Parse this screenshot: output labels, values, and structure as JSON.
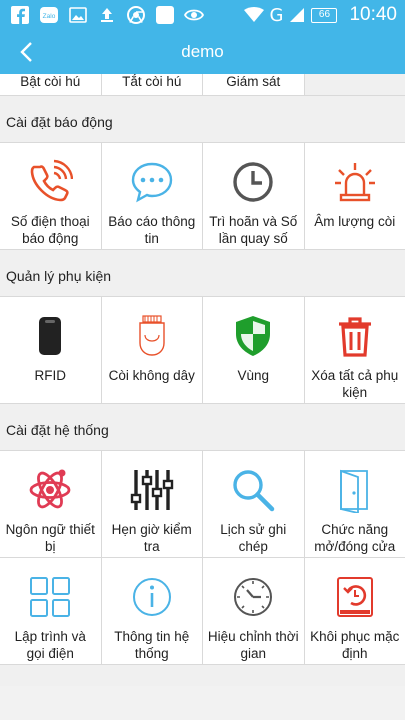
{
  "status_bar": {
    "time": "10:40",
    "battery": "66",
    "network": "G",
    "notification_icons": [
      "facebook-icon",
      "zalo-icon",
      "image-icon",
      "upload-icon",
      "chrome-icon",
      "app-icon",
      "eye-icon"
    ],
    "zalo_label": "Zalo"
  },
  "app_bar": {
    "title": "demo"
  },
  "top_row": [
    "Bật còi hú",
    "Tắt còi hú",
    "Giám sát"
  ],
  "sections": [
    {
      "title": "Cài đặt báo động",
      "items": [
        {
          "label": "Số điện thoại báo động",
          "icon": "phone-ring-icon",
          "color": "#e8512a"
        },
        {
          "label": "Báo cáo thông tin",
          "icon": "chat-bubble-icon",
          "color": "#4ab3e6"
        },
        {
          "label": "Trì hoãn và Số lần quay số",
          "icon": "clock-icon",
          "color": "#555555"
        },
        {
          "label": "Âm lượng còi",
          "icon": "siren-icon",
          "color": "#e8512a"
        }
      ]
    },
    {
      "title": "Quản lý phụ kiện",
      "items": [
        {
          "label": "RFID",
          "icon": "rfid-tag-icon",
          "color": "#222222"
        },
        {
          "label": "Còi không dây",
          "icon": "wireless-siren-icon",
          "color": "#e8512a"
        },
        {
          "label": "Vùng",
          "icon": "shield-icon",
          "color": "#1f9e2c"
        },
        {
          "label": "Xóa tất cả phụ kiện",
          "icon": "trash-icon",
          "color": "#e23a2c"
        }
      ]
    },
    {
      "title": "Cài đặt hệ thống",
      "items": [
        {
          "label": "Ngôn ngữ thiết bị",
          "icon": "atom-icon",
          "color": "#e03b54"
        },
        {
          "label": "Hẹn giờ kiểm tra",
          "icon": "equalizer-icon",
          "color": "#222222"
        },
        {
          "label": "Lịch sử ghi chép",
          "icon": "magnifier-icon",
          "color": "#4ab3e6"
        },
        {
          "label": "Chức năng mở/đóng cửa",
          "icon": "door-icon",
          "color": "#4ab3e6"
        },
        {
          "label": "Lập trình và gọi điện",
          "icon": "grid-icon",
          "color": "#4ab3e6"
        },
        {
          "label": "Thông tin hệ thống",
          "icon": "info-icon",
          "color": "#4ab3e6"
        },
        {
          "label": "Hiệu chỉnh thời gian",
          "icon": "wall-clock-icon",
          "color": "#555555"
        },
        {
          "label": "Khôi phục mặc định",
          "icon": "restore-icon",
          "color": "#e23a2c"
        }
      ]
    }
  ]
}
